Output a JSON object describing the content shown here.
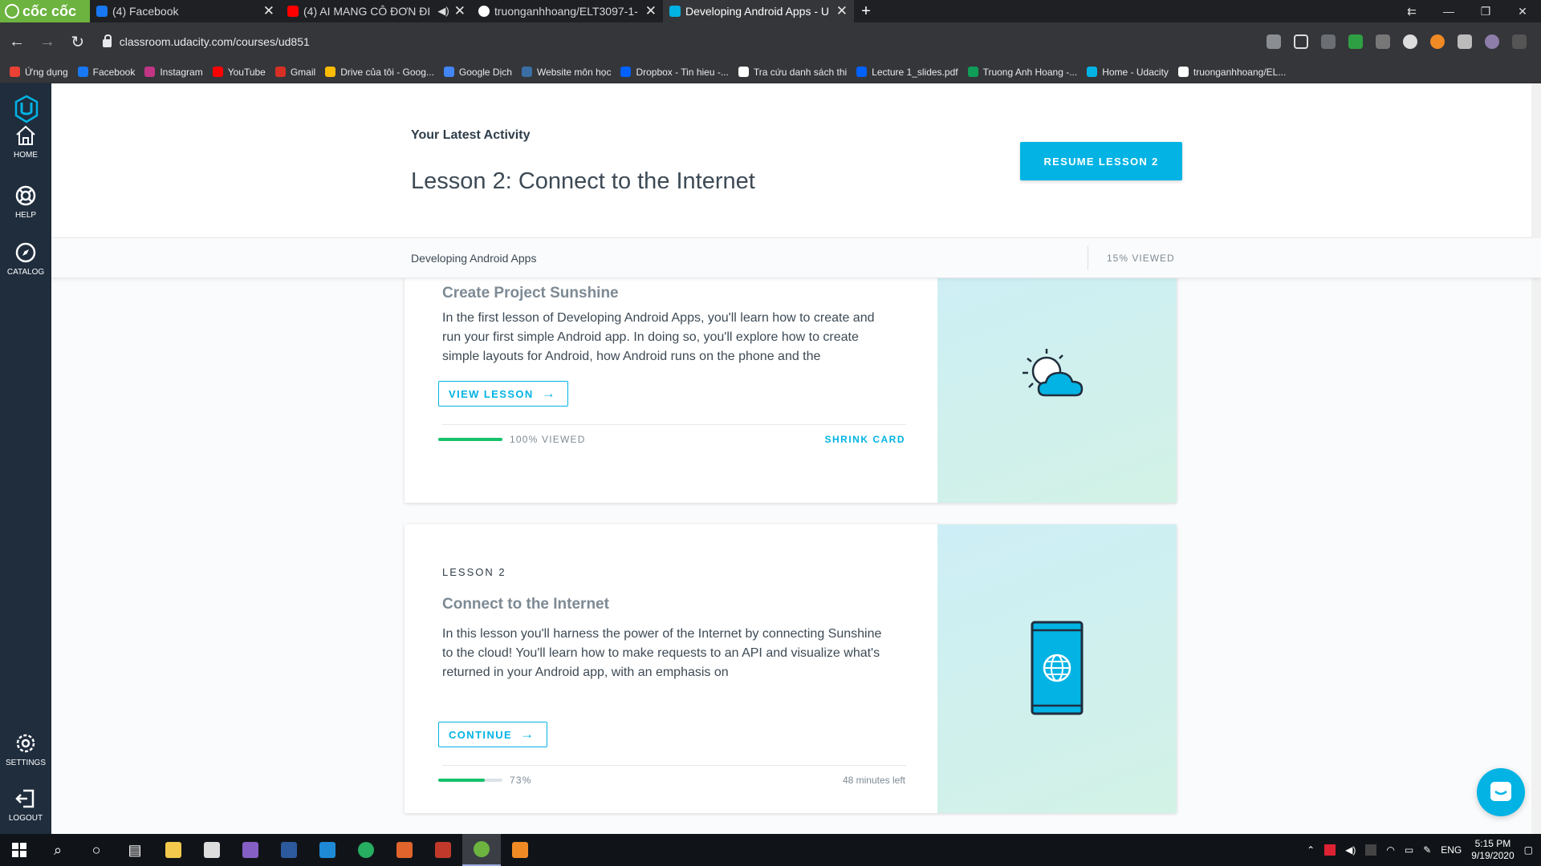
{
  "browser": {
    "brand": "cốc cốc",
    "tabs": [
      {
        "title": "(4) Facebook",
        "color": "#1877f2",
        "active": false
      },
      {
        "title": "(4) AI MANG CÔ ĐƠN ĐI",
        "color": "#ff0000",
        "active": false
      },
      {
        "title": "truonganhhoang/ELT3097-1-",
        "color": "#ffffff",
        "active": false
      },
      {
        "title": "Developing Android Apps - U",
        "color": "#02b3e4",
        "active": true
      }
    ],
    "url": "classroom.udacity.com/courses/ud851",
    "bookmarks": [
      {
        "label": "Ứng dụng",
        "color": "#e94235"
      },
      {
        "label": "Facebook",
        "color": "#1877f2"
      },
      {
        "label": "Instagram",
        "color": "#c13584"
      },
      {
        "label": "YouTube",
        "color": "#ff0000"
      },
      {
        "label": "Gmail",
        "color": "#d93025"
      },
      {
        "label": "Drive của tôi - Goog...",
        "color": "#fbbc04"
      },
      {
        "label": "Google Dịch",
        "color": "#4285f4"
      },
      {
        "label": "Website môn học",
        "color": "#3b6ea5"
      },
      {
        "label": "Dropbox - Tin hieu -...",
        "color": "#0061ff"
      },
      {
        "label": "Tra cứu danh sách thi",
        "color": "#ffffff"
      },
      {
        "label": "Lecture 1_slides.pdf",
        "color": "#0061ff"
      },
      {
        "label": "Truong Anh Hoang -...",
        "color": "#0f9d58"
      },
      {
        "label": "Home - Udacity",
        "color": "#02b3e4"
      },
      {
        "label": "truonganhhoang/EL...",
        "color": "#ffffff"
      }
    ]
  },
  "sidebar": {
    "items": [
      {
        "label": "HOME",
        "icon": "home-icon"
      },
      {
        "label": "HELP",
        "icon": "help-lifebuoy-icon"
      },
      {
        "label": "CATALOG",
        "icon": "compass-icon"
      },
      {
        "label": "SETTINGS",
        "icon": "gear-icon"
      },
      {
        "label": "LOGOUT",
        "icon": "logout-icon"
      }
    ]
  },
  "header": {
    "latest_label": "Your Latest Activity",
    "lesson_title": "Lesson 2: Connect to the Internet",
    "resume_button": "RESUME LESSON 2"
  },
  "subbar": {
    "course_name": "Developing Android Apps",
    "viewed": "15% VIEWED"
  },
  "lessons": [
    {
      "title": "Create Project Sunshine",
      "description": "In the first lesson of Developing Android Apps, you'll learn how to create and run your first simple Android app. In doing so, you'll explore how to create simple layouts for Android, how Android runs on the phone and the",
      "button": "VIEW LESSON",
      "progress": 1.0,
      "progress_text": "100% VIEWED",
      "action": "SHRINK CARD",
      "art_icon": "sun-cloud-icon"
    },
    {
      "label": "LESSON 2",
      "title": "Connect to the Internet",
      "description": "In this lesson you'll harness the power of the Internet by connecting Sunshine to the cloud! You'll learn how to make requests to an API and visualize what's returned in your Android app, with an emphasis on",
      "button": "CONTINUE",
      "progress": 0.73,
      "progress_text": "73%",
      "time_left": "48 minutes left",
      "art_icon": "phone-globe-icon"
    }
  ],
  "taskbar": {
    "language": "ENG",
    "time": "5:15 PM",
    "date": "9/19/2020"
  },
  "colors": {
    "accent": "#02b3e4",
    "sidebar": "#1f2d3d",
    "progress": "#15c26b"
  }
}
